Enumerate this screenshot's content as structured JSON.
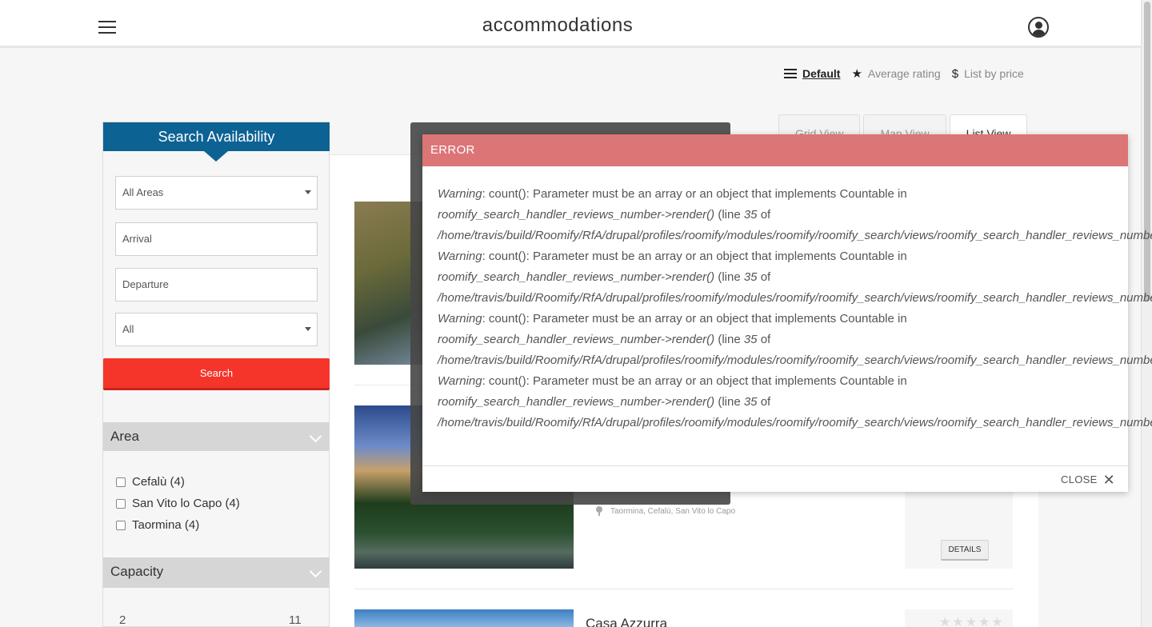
{
  "header": {
    "title": "accommodations"
  },
  "sort": {
    "items": [
      {
        "label": "Default",
        "icon": "list-icon",
        "active": true
      },
      {
        "label": "Average rating",
        "icon": "star-icon",
        "active": false
      },
      {
        "label": "List by price",
        "icon": "dollar-icon",
        "active": false
      }
    ]
  },
  "views": {
    "tabs": [
      "Grid View",
      "Map View",
      "List View"
    ]
  },
  "search": {
    "title": "Search Availability",
    "area_select": "All Areas",
    "arrival_placeholder": "Arrival",
    "departure_placeholder": "Departure",
    "type_select": "All",
    "button": "Search"
  },
  "facets": {
    "area": {
      "title": "Area",
      "items": [
        "Cefalù (4)",
        "San Vito lo Capo (4)",
        "Taormina (4)"
      ]
    },
    "capacity": {
      "title": "Capacity",
      "min": "2",
      "max": "11"
    }
  },
  "listings": [
    {
      "location": "Taormina, Cefalù, San Vito lo Capo",
      "details": "DETAILS"
    },
    {
      "title": "Casa Azzurra",
      "stars": "★★★★★"
    }
  ],
  "error": {
    "title": "ERROR",
    "messages": [
      {
        "kind": "Warning",
        "text": ": count(): Parameter must be an array or an object that implements Countable in ",
        "handler": "roomify_search_handler_reviews_number->render()",
        "line_pre": " (line ",
        "line": "35",
        "line_post": " of ",
        "path": "/home/travis/build/Roomify/RfA/drupal/profiles/roomify/modules/roomify/roomify_search/views/roomify_search_handler_reviews_number.inc",
        "end": ")."
      },
      {
        "kind": "Warning",
        "text": ": count(): Parameter must be an array or an object that implements Countable in ",
        "handler": "roomify_search_handler_reviews_number->render()",
        "line_pre": " (line ",
        "line": "35",
        "line_post": " of ",
        "path": "/home/travis/build/Roomify/RfA/drupal/profiles/roomify/modules/roomify/roomify_search/views/roomify_search_handler_reviews_number.inc",
        "end": ")."
      },
      {
        "kind": "Warning",
        "text": ": count(): Parameter must be an array or an object that implements Countable in ",
        "handler": "roomify_search_handler_reviews_number->render()",
        "line_pre": " (line ",
        "line": "35",
        "line_post": " of ",
        "path": "/home/travis/build/Roomify/RfA/drupal/profiles/roomify/modules/roomify/roomify_search/views/roomify_search_handler_reviews_number.inc",
        "end": ")."
      },
      {
        "kind": "Warning",
        "text": ": count(): Parameter must be an array or an object that implements Countable in ",
        "handler": "roomify_search_handler_reviews_number->render()",
        "line_pre": " (line ",
        "line": "35",
        "line_post": " of ",
        "path": "/home/travis/build/Roomify/RfA/drupal/profiles/roomify/modules/roomify/roomify_search/views/roomify_search_handler_reviews_number.inc",
        "end": ")."
      }
    ],
    "close": "CLOSE"
  },
  "colors": {
    "brand": "#0d6294",
    "search_button": "#f5352a",
    "error_header": "#dc7576"
  }
}
